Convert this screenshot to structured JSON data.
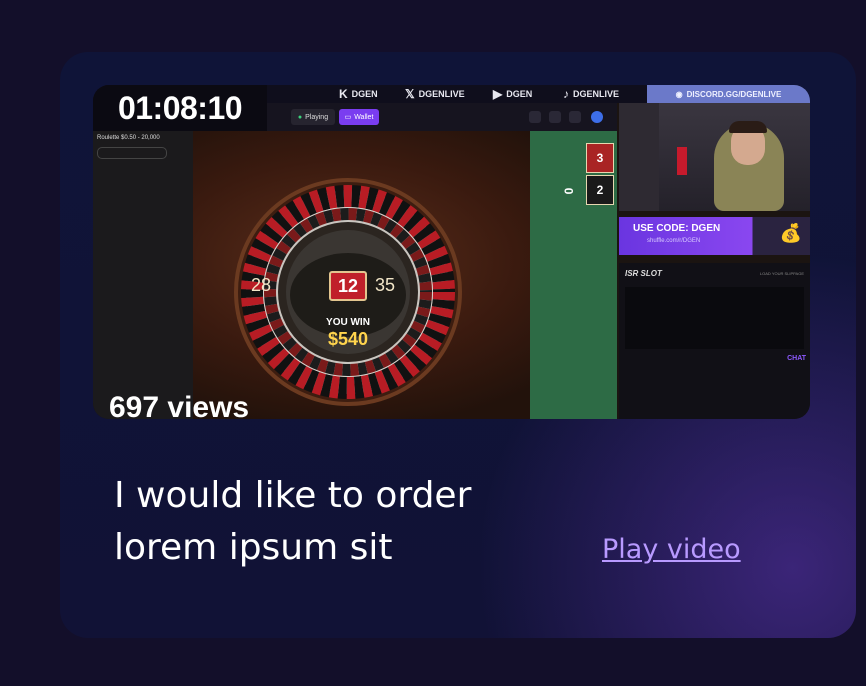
{
  "video": {
    "timer": "01:08:10",
    "views": "697 views",
    "socials": [
      {
        "icon": "kick-icon",
        "glyph": "K",
        "label": "DGEN"
      },
      {
        "icon": "x-icon",
        "glyph": "𝕏",
        "label": "DGENLIVE"
      },
      {
        "icon": "youtube-icon",
        "glyph": "▶",
        "label": "DGEN"
      },
      {
        "icon": "tiktok-icon",
        "glyph": "♪",
        "label": "DGENLIVE"
      }
    ],
    "discord": "DISCORD.GG/DGENLIVE",
    "status_pill": "Playing",
    "wallet_pill": "Wallet",
    "game_label": "Roulette $0.50 - 20,000",
    "winning_number": "12",
    "neighbor_left": "28",
    "neighbor_right": "35",
    "win_label": "YOU WIN",
    "win_amount": "$540",
    "felt_numbers": [
      "3",
      "2",
      "0"
    ],
    "promo_code": "USE CODE: DGEN",
    "promo_url": "shuffle.com/r/DGEN",
    "panel_title": "ISR SLOT",
    "panel_link": "LOAD YOUR SLIPPAGE",
    "chat_label": "CHAT",
    "accent": "#8a47f0"
  },
  "card": {
    "title": "I would like to order lorem ipsum sit",
    "title_line1": "I would like to order",
    "title_line2": "lorem ipsum sit",
    "cta": "Play video",
    "cta_color": "#b89aff",
    "background": "#0f1438"
  }
}
